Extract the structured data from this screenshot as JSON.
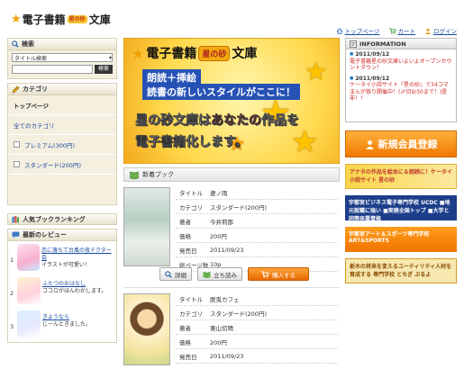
{
  "header": {
    "logo_text": "電子書籍",
    "logo_badge": "星の砂",
    "logo_suffix": "文庫",
    "links": [
      "トップページ",
      "カート",
      "ログイン"
    ]
  },
  "search": {
    "title": "検索",
    "select_value": "タイトル検索",
    "button": "検索"
  },
  "category": {
    "title": "カテゴリ",
    "items": [
      {
        "label": "トップページ"
      },
      {
        "label": "全てのカテゴリ"
      },
      {
        "label": "プレミアム(300円)"
      },
      {
        "label": "スタンダード(200円)"
      }
    ]
  },
  "ranking": {
    "title": "人気ブックランキング"
  },
  "reviews": {
    "title": "最新のレビュー",
    "items": [
      {
        "num": "1",
        "title": "恋に落ちて台風の夜ドクター会",
        "text": "イラストが可愛い！"
      },
      {
        "num": "2",
        "title": "ふたつのおはなし",
        "text": "ココロがほんわかします。"
      },
      {
        "num": "3",
        "title": "きようなら",
        "text": "じーんときました。"
      }
    ]
  },
  "banner": {
    "title": "電子書籍",
    "badge": "星の砂",
    "suffix": "文庫",
    "line1": "朗読＋挿絵",
    "line2": "読書の新しいスタイルがここに！",
    "line3_a": "星の砂文庫は",
    "line3_hl": "あなたの",
    "line3_b": "作品を",
    "line4": "電子書籍化します。"
  },
  "new_books": {
    "title": "新着ブック",
    "books": [
      {
        "rows": [
          {
            "k": "タイトル",
            "v": "遼ノ雨"
          },
          {
            "k": "カテゴリ",
            "v": "スタンダード(200円)"
          },
          {
            "k": "著者",
            "v": "今井莉那"
          },
          {
            "k": "価格",
            "v": "200円"
          },
          {
            "k": "発売日",
            "v": "2011/09/23"
          },
          {
            "k": "総ページ数",
            "v": "10p"
          }
        ],
        "buttons": {
          "detail": "詳細",
          "trial": "立ち読み",
          "buy": "購入する"
        }
      },
      {
        "rows": [
          {
            "k": "タイトル",
            "v": "脱兎カフェ"
          },
          {
            "k": "カテゴリ",
            "v": "スタンダード(200円)"
          },
          {
            "k": "著者",
            "v": "東山切晴"
          },
          {
            "k": "価格",
            "v": "200円"
          },
          {
            "k": "発売日",
            "v": "2011/09/23"
          }
        ]
      }
    ]
  },
  "information": {
    "title": "INFORMATION",
    "news": [
      {
        "date": "2011/09/12",
        "text": "電子書籍星の砂文庫いよいよオープンカウントダウン！"
      },
      {
        "date": "2011/09/12",
        "text": "ケータイ小説サイト『星の砂』で34コマまんが祭り開催中！(〆切9/30まで！)是非！！"
      }
    ]
  },
  "register_button": "新規会員登録",
  "ads": [
    {
      "text": "アナタの作品を絵本に＆朗読に！ケータイ小説サイト 星の砂"
    },
    {
      "text": "宇都宮ビジネス電子専門学校 UCDC ■地元就職に強い ■実務全国トップ ■大学と同等卒業資格"
    },
    {
      "text": "宇都宮アート＆スポーツ専門学校 ART&SPORTS"
    },
    {
      "text": "栃木の将来を変えるユーティリティ人材を育成する 専門学校 とちぎ ぶるよ"
    }
  ],
  "colors": {
    "accent_orange": "#f07800",
    "link_blue": "#1a4aa0",
    "banner_yellow": "#ffd84a",
    "banner_blue": "#2752b5",
    "sidebar_bg": "#f4efdf"
  }
}
